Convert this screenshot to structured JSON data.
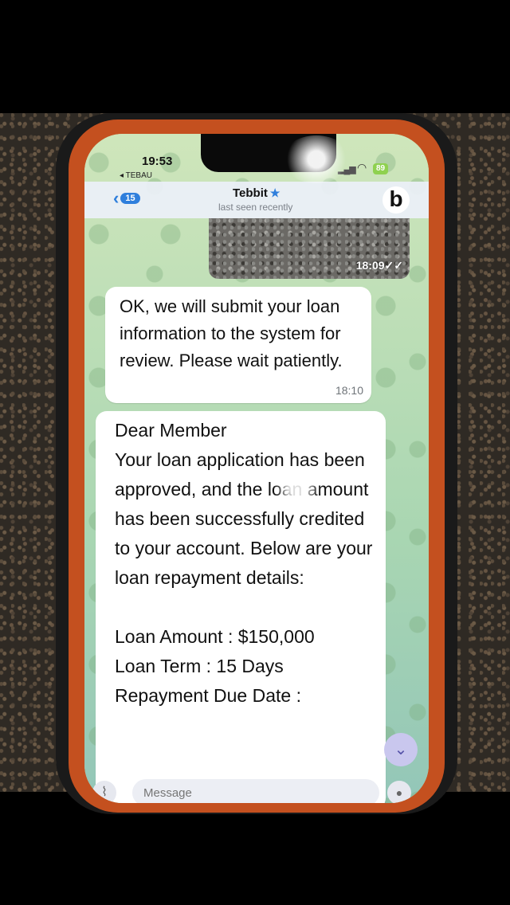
{
  "status_bar": {
    "time": "19:53",
    "back_app": "◂ TEBAU",
    "battery": "89"
  },
  "header": {
    "back_count": "15",
    "contact_name": "Tebbit",
    "contact_status": "last seen recently",
    "avatar_letter": "b"
  },
  "messages": {
    "image_time": "18:09",
    "bubble1_text": "OK, we will submit your loan information to the system for review. Please wait patiently.",
    "bubble1_time": "18:10",
    "bubble2_text": "Dear Member\nYour loan application has been approved, and the loan amount has been successfully credited to your account. Below are your loan repayment details:\n\nLoan Amount : $150,000\nLoan Term : 15 Days\nRepayment Due Date :"
  },
  "input": {
    "placeholder": "Message"
  },
  "icons": {
    "back": "chevron-left-icon",
    "verified": "star-icon",
    "read": "double-check-icon",
    "scroll": "chevron-down-icon",
    "attach": "paperclip-icon",
    "mic": "microphone-icon"
  },
  "colors": {
    "accent": "#2f7fdc",
    "bumper": "#c4501f",
    "battery": "#8fd14f"
  }
}
